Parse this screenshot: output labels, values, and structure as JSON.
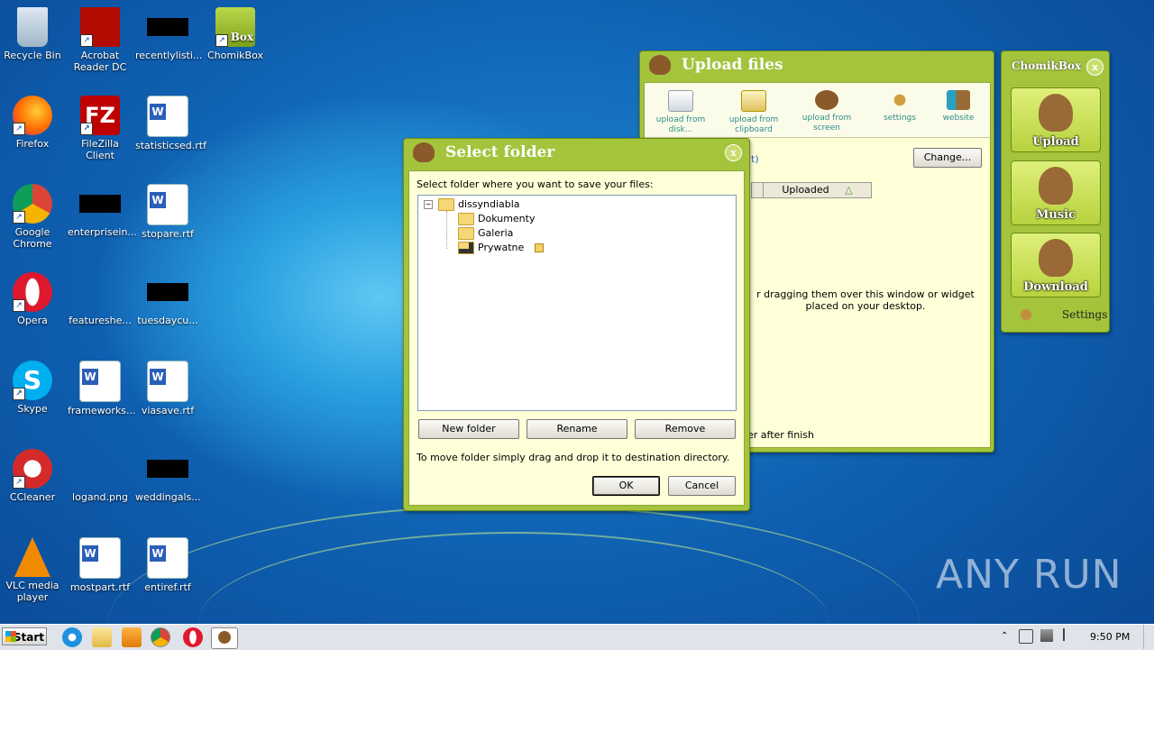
{
  "desktop": {
    "icons": [
      {
        "label": "Recycle Bin"
      },
      {
        "label": "Acrobat Reader DC"
      },
      {
        "label": "recentlylisti..."
      },
      {
        "label": "ChomikBox"
      },
      {
        "label": "Firefox"
      },
      {
        "label": "FileZilla Client"
      },
      {
        "label": "statisticsed.rtf"
      },
      {
        "label": "Google Chrome"
      },
      {
        "label": "enterprisein..."
      },
      {
        "label": "stopare.rtf"
      },
      {
        "label": "Opera"
      },
      {
        "label": "featureshe..."
      },
      {
        "label": "tuesdaycu..."
      },
      {
        "label": "Skype"
      },
      {
        "label": "frameworks..."
      },
      {
        "label": "viasave.rtf"
      },
      {
        "label": "CCleaner"
      },
      {
        "label": "logand.png"
      },
      {
        "label": "weddingals..."
      },
      {
        "label": "VLC media player"
      },
      {
        "label": "mostpart.rtf"
      },
      {
        "label": "entiref.rtf"
      }
    ],
    "chomikbox_icon_badge": "Box"
  },
  "upload_window": {
    "title": "Upload files",
    "toolbar": {
      "upload_disk": "upload from disk...",
      "upload_clipboard": "upload from clipboard",
      "upload_screen": "upload from screen",
      "settings": "settings",
      "website": "website"
    },
    "partial_link": "t)",
    "change_button": "Change...",
    "column_uploaded": "Uploaded",
    "hint": "r dragging them over this window or widget placed on your desktop.",
    "after_finish": "er after finish"
  },
  "select_folder": {
    "title": "Select folder",
    "instruction": "Select folder where you want to save your files:",
    "tree": {
      "root": "dissyndiabla",
      "children": [
        "Dokumenty",
        "Galeria",
        "Prywatne"
      ]
    },
    "buttons": {
      "new_folder": "New folder",
      "rename": "Rename",
      "remove": "Remove",
      "ok": "OK",
      "cancel": "Cancel"
    },
    "footer_text": "To move folder simply drag and drop it to destination directory."
  },
  "chomikbox_widget": {
    "title": "ChomikBox",
    "upload": "Upload",
    "music": "Music",
    "download": "Download",
    "settings": "Settings"
  },
  "taskbar": {
    "start": "Start",
    "time": "9:50 PM"
  },
  "watermark": "ANY RUN"
}
